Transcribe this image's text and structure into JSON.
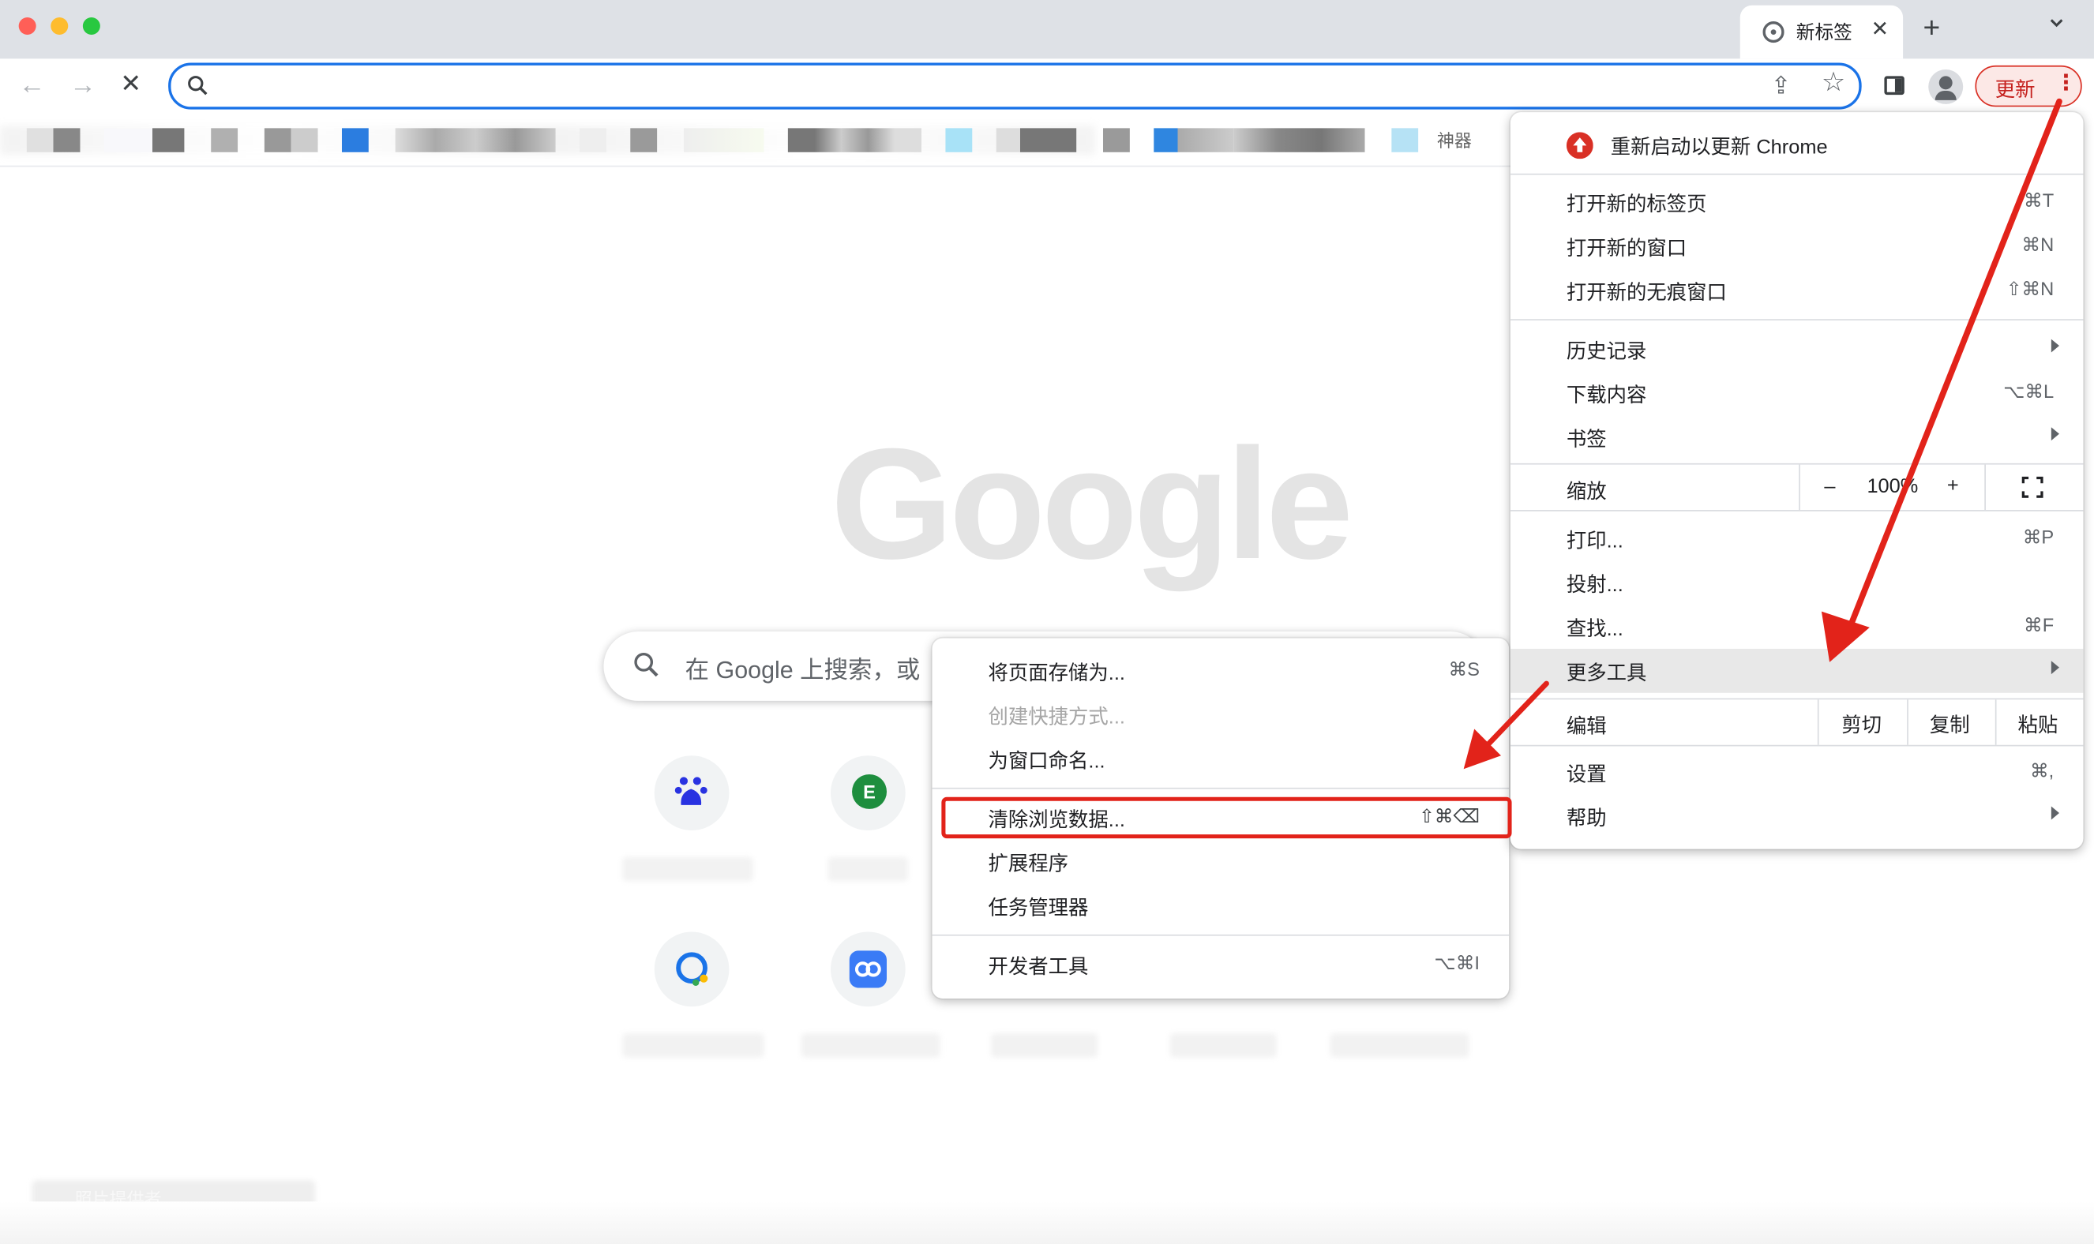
{
  "window": {
    "tab": {
      "title": "新标签"
    }
  },
  "toolbar": {
    "back_icon": "arrow-left-icon",
    "forward_icon": "arrow-right-icon",
    "stop_icon": "close-icon",
    "omnibox_value": "",
    "update_label": "更新",
    "menu_glyph": "⋮",
    "close_glyph": "✕",
    "plus_glyph": "+",
    "arrow_left_glyph": "←",
    "arrow_right_glyph": "→",
    "stop_glyph": "✕",
    "share_glyph": "⇪",
    "star_glyph": "☆"
  },
  "bookmarks": {
    "last_label": "神器"
  },
  "page": {
    "logo": "Google",
    "search_placeholder": "在 Google 上搜索，或",
    "footer_credit": "照片提供者"
  },
  "chrome_menu": {
    "restart_update": "重新启动以更新 Chrome",
    "new_tab": {
      "label": "打开新的标签页",
      "shortcut": "⌘T"
    },
    "new_window": {
      "label": "打开新的窗口",
      "shortcut": "⌘N"
    },
    "new_incognito": {
      "label": "打开新的无痕窗口",
      "shortcut": "⇧⌘N"
    },
    "history": {
      "label": "历史记录"
    },
    "downloads": {
      "label": "下载内容",
      "shortcut": "⌥⌘L"
    },
    "bookmarks": {
      "label": "书签"
    },
    "zoom": {
      "label": "缩放",
      "minus": "–",
      "value": "100%",
      "plus": "+",
      "fullscreen_icon": "fullscreen-icon"
    },
    "print": {
      "label": "打印...",
      "shortcut": "⌘P"
    },
    "cast": {
      "label": "投射..."
    },
    "find": {
      "label": "查找...",
      "shortcut": "⌘F"
    },
    "more_tools": {
      "label": "更多工具"
    },
    "edit": {
      "label": "编辑",
      "cut": "剪切",
      "copy": "复制",
      "paste": "粘贴"
    },
    "settings": {
      "label": "设置",
      "shortcut": "⌘,"
    },
    "help": {
      "label": "帮助"
    }
  },
  "more_tools_menu": {
    "save_page": {
      "label": "将页面存储为...",
      "shortcut": "⌘S"
    },
    "create_shortcut": {
      "label": "创建快捷方式..."
    },
    "name_window": {
      "label": "为窗口命名..."
    },
    "clear_data": {
      "label": "清除浏览数据...",
      "shortcut": "⇧⌘⌫"
    },
    "extensions": {
      "label": "扩展程序"
    },
    "task_manager": {
      "label": "任务管理器"
    },
    "dev_tools": {
      "label": "开发者工具",
      "shortcut": "⌥⌘I"
    }
  },
  "colors": {
    "accent": "#1a73e8",
    "update_red": "#d93025",
    "annotation_red": "#e2231a"
  }
}
